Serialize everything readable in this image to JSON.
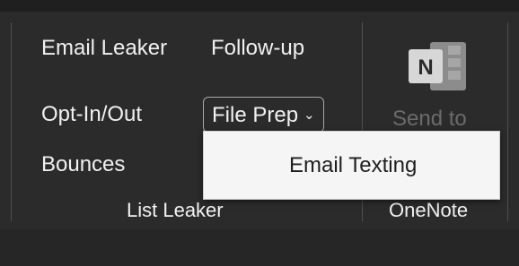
{
  "list_leaker": {
    "buttons": {
      "email_leaker": "Email Leaker",
      "follow_up": "Follow-up",
      "opt_in_out": "Opt-In/Out",
      "file_prep": "File Prep",
      "bounces": "Bounces"
    },
    "group_label": "List Leaker"
  },
  "onenote": {
    "icon_letter": "N",
    "send_to_label": "Send to",
    "group_label": "OneNote"
  },
  "file_prep_menu": {
    "items": [
      "Email Texting"
    ]
  },
  "icons": {
    "dropdown": "chevron-down-icon",
    "onenote": "onenote-icon"
  },
  "colors": {
    "ribbon_background": "#2b2b2b",
    "text": "#f1f1f1",
    "disabled_text": "#6b6b6b",
    "menu_background": "#f5f5f5",
    "menu_text": "#1f1f1f",
    "onenote_icon": "#d7d7d7"
  }
}
